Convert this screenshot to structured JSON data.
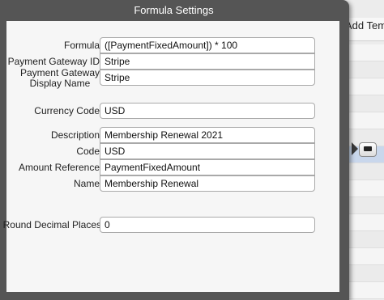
{
  "background": {
    "add_button_label": "Add Temp"
  },
  "dialog": {
    "title": "Formula Settings",
    "fields": {
      "formula": {
        "label": "Formula",
        "value": "([PaymentFixedAmount]) * 100"
      },
      "gateway_id": {
        "label": "Payment Gateway ID",
        "value": "Stripe"
      },
      "gateway_display_name": {
        "label_line1": "Payment Gateway",
        "label_line2": "Display Name",
        "value": "Stripe"
      },
      "currency_code": {
        "label": "Currency Code",
        "value": "USD"
      },
      "description": {
        "label": "Description",
        "value": "Membership Renewal 2021"
      },
      "code": {
        "label": "Code",
        "value": "USD"
      },
      "amount_reference": {
        "label": "Amount Reference",
        "value": "PaymentFixedAmount"
      },
      "name": {
        "label": "Name",
        "value": "Membership Renewal"
      },
      "round_decimal_places": {
        "label": "Round Decimal Places",
        "value": "0"
      }
    }
  }
}
